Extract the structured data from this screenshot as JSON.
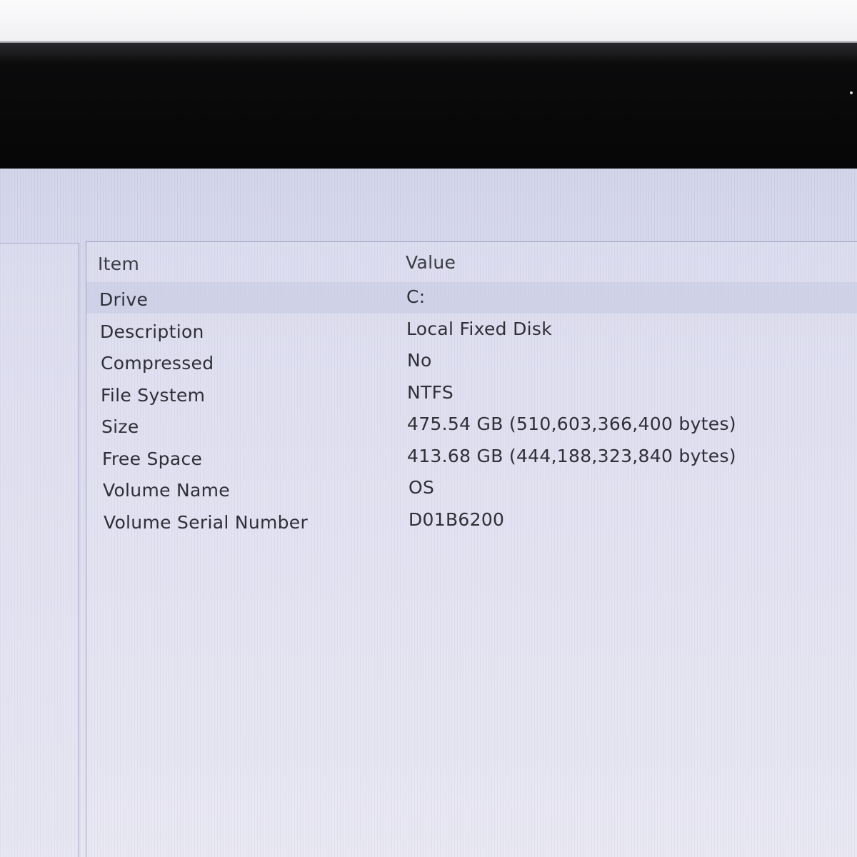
{
  "columns": {
    "item": "Item",
    "value": "Value"
  },
  "rows": [
    {
      "item": "Drive",
      "value": "C:"
    },
    {
      "item": "Description",
      "value": "Local Fixed Disk"
    },
    {
      "item": "Compressed",
      "value": "No"
    },
    {
      "item": "File System",
      "value": "NTFS"
    },
    {
      "item": "Size",
      "value": "475.54 GB (510,603,366,400 bytes)"
    },
    {
      "item": "Free Space",
      "value": "413.68 GB (444,188,323,840 bytes)"
    },
    {
      "item": "Volume Name",
      "value": "OS"
    },
    {
      "item": "Volume Serial Number",
      "value": "D01B6200"
    }
  ],
  "selected_row": 0
}
